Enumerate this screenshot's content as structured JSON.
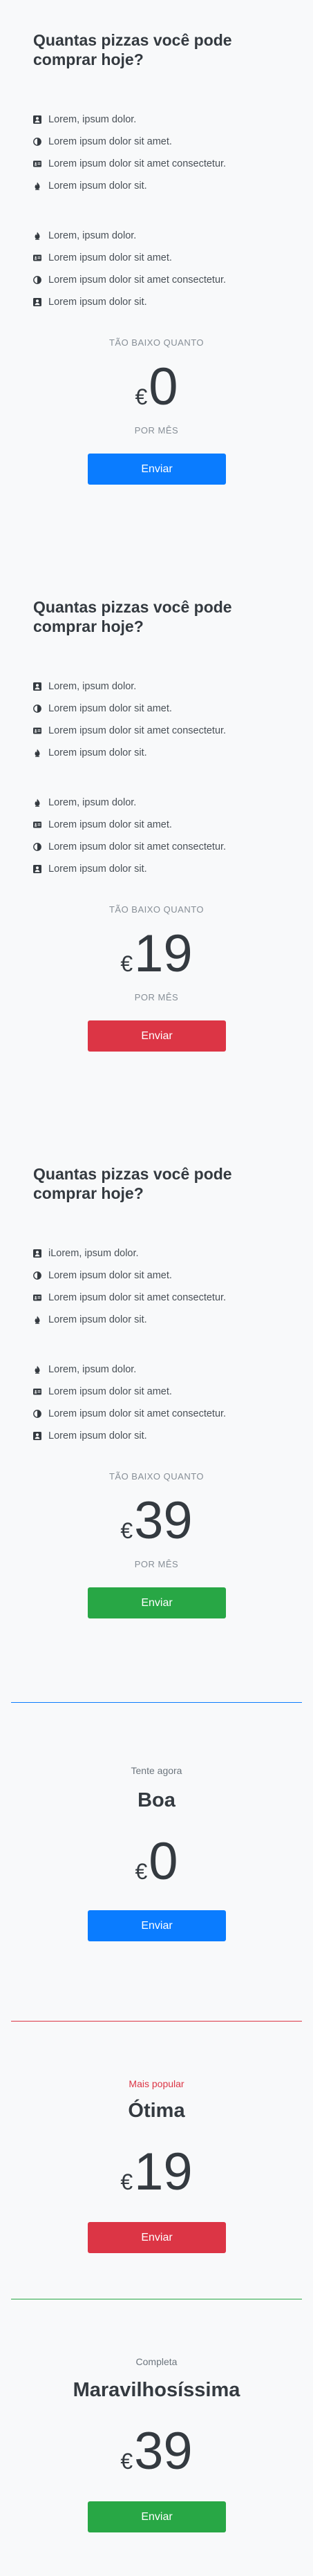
{
  "plans": [
    {
      "title": "Quantas pizzas você pode comprar hoje?",
      "features_a": [
        {
          "icon": "user-icon",
          "text": "Lorem, ipsum dolor."
        },
        {
          "icon": "half-circle-icon",
          "text": "Lorem ipsum dolor sit amet."
        },
        {
          "icon": "id-card-icon",
          "text": "Lorem ipsum dolor sit amet consectetur."
        },
        {
          "icon": "fire-icon",
          "text": "Lorem ipsum dolor sit."
        }
      ],
      "features_b": [
        {
          "icon": "fire-icon",
          "text": "Lorem, ipsum dolor."
        },
        {
          "icon": "id-card-icon",
          "text": "Lorem ipsum dolor sit amet."
        },
        {
          "icon": "half-circle-icon",
          "text": "Lorem ipsum dolor sit amet consectetur."
        },
        {
          "icon": "user-icon",
          "text": "Lorem ipsum dolor sit."
        }
      ],
      "as_low_as": "TÃO BAIXO QUANTO",
      "currency": "€",
      "price": "0",
      "per_month": "POR MÊS",
      "button": "Enviar",
      "button_color": "#0a7cff"
    },
    {
      "title": "Quantas pizzas você pode comprar hoje?",
      "features_a": [
        {
          "icon": "user-icon",
          "text": "Lorem, ipsum dolor."
        },
        {
          "icon": "half-circle-icon",
          "text": "Lorem ipsum dolor sit amet."
        },
        {
          "icon": "id-card-icon",
          "text": "Lorem ipsum dolor sit amet consectetur."
        },
        {
          "icon": "fire-icon",
          "text": "Lorem ipsum dolor sit."
        }
      ],
      "features_b": [
        {
          "icon": "fire-icon",
          "text": "Lorem, ipsum dolor."
        },
        {
          "icon": "id-card-icon",
          "text": "Lorem ipsum dolor sit amet."
        },
        {
          "icon": "half-circle-icon",
          "text": "Lorem ipsum dolor sit amet consectetur."
        },
        {
          "icon": "user-icon",
          "text": "Lorem ipsum dolor sit."
        }
      ],
      "as_low_as": "TÃO BAIXO QUANTO",
      "currency": "€",
      "price": "19",
      "per_month": "POR MÊS",
      "button": "Enviar",
      "button_color": "#dc3545"
    },
    {
      "title": "Quantas pizzas você pode comprar hoje?",
      "features_a": [
        {
          "icon": "user-icon",
          "text": "iLorem, ipsum dolor."
        },
        {
          "icon": "half-circle-icon",
          "text": "Lorem ipsum dolor sit amet."
        },
        {
          "icon": "id-card-icon",
          "text": "Lorem ipsum dolor sit amet consectetur."
        },
        {
          "icon": "fire-icon",
          "text": "Lorem ipsum dolor sit."
        }
      ],
      "features_b": [
        {
          "icon": "fire-icon",
          "text": "Lorem, ipsum dolor."
        },
        {
          "icon": "id-card-icon",
          "text": "Lorem ipsum dolor sit amet."
        },
        {
          "icon": "half-circle-icon",
          "text": "Lorem ipsum dolor sit amet consectetur."
        },
        {
          "icon": "user-icon",
          "text": "Lorem ipsum dolor sit."
        }
      ],
      "as_low_as": "TÃO BAIXO QUANTO",
      "currency": "€",
      "price": "39",
      "per_month": "POR MÊS",
      "button": "Enviar",
      "button_color": "#28a745"
    }
  ],
  "tiers": [
    {
      "label": "Tente agora",
      "name": "Boa",
      "currency": "€",
      "price": "0",
      "button": "Enviar",
      "accent": "#0a7cff",
      "label_color": "#6c757d"
    },
    {
      "label": "Mais popular",
      "name": "Ótima",
      "currency": "€",
      "price": "19",
      "button": "Enviar",
      "accent": "#dc3545",
      "label_color": "#dc3545"
    },
    {
      "label": "Completa",
      "name": "Maravilhosíssima",
      "currency": "€",
      "price": "39",
      "button": "Enviar",
      "accent": "#28a745",
      "label_color": "#6c757d"
    }
  ]
}
